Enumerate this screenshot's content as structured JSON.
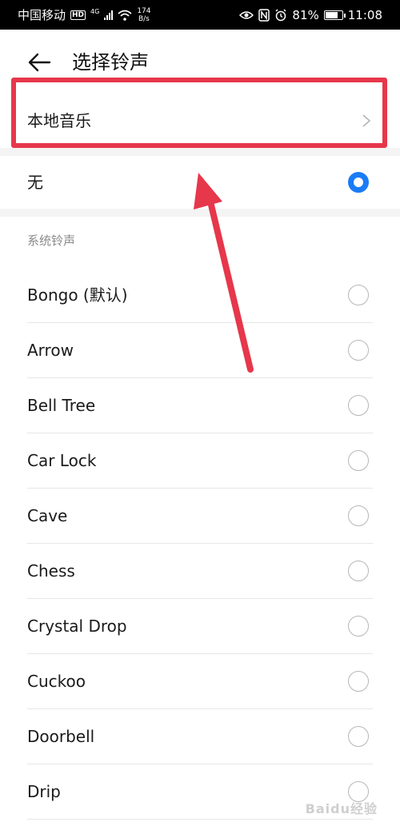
{
  "status_bar": {
    "carrier": "中国移动",
    "hd": "HD",
    "network": "4G",
    "speed_value": "174",
    "speed_unit": "B/s",
    "battery": "81%",
    "battery_level": 0.81,
    "time": "11:08",
    "icons": [
      "eye-icon",
      "nfc-icon",
      "alarm-icon",
      "battery-icon",
      "wifi-icon",
      "signal-icon"
    ]
  },
  "header": {
    "title": "选择铃声",
    "back_icon": "arrow-left-icon"
  },
  "local_music": {
    "label": "本地音乐",
    "chevron_icon": "chevron-right-icon"
  },
  "none_option": {
    "label": "无",
    "selected": true
  },
  "system_section": {
    "header": "系统铃声",
    "items": [
      {
        "label": "Bongo (默认)",
        "selected": false
      },
      {
        "label": "Arrow",
        "selected": false
      },
      {
        "label": "Bell Tree",
        "selected": false
      },
      {
        "label": "Car Lock",
        "selected": false
      },
      {
        "label": "Cave",
        "selected": false
      },
      {
        "label": "Chess",
        "selected": false
      },
      {
        "label": "Crystal Drop",
        "selected": false
      },
      {
        "label": "Cuckoo",
        "selected": false
      },
      {
        "label": "Doorbell",
        "selected": false
      },
      {
        "label": "Drip",
        "selected": false
      }
    ]
  },
  "colors": {
    "accent": "#1a7cf5",
    "annotation": "#e6374b",
    "status_bar_bg": "#000000",
    "section_text": "#8a8a8a"
  },
  "watermark": "Baidu经验"
}
